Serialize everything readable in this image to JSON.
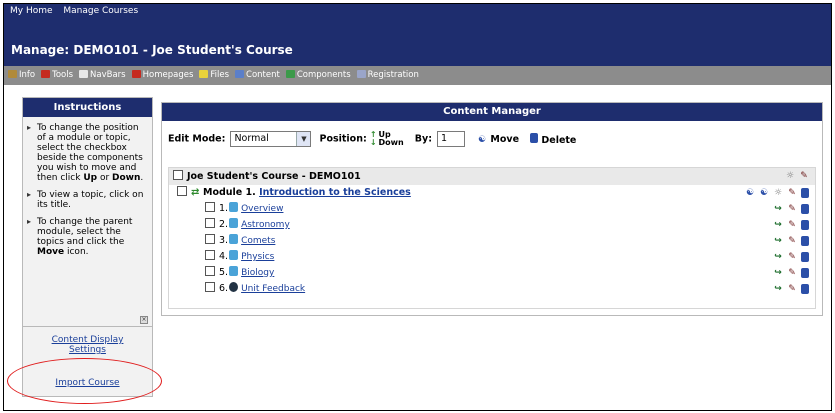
{
  "topnav": {
    "home": "My Home",
    "courses": "Manage Courses"
  },
  "title": "Manage: DEMO101 - Joe Student's Course",
  "toolbar": {
    "items": [
      {
        "label": "Info",
        "color": "#b08a3a"
      },
      {
        "label": "Tools",
        "color": "#c52a1f"
      },
      {
        "label": "NavBars",
        "color": "#e8e8e8"
      },
      {
        "label": "Homepages",
        "color": "#c52a1f"
      },
      {
        "label": "Files",
        "color": "#e9d23a"
      },
      {
        "label": "Content",
        "color": "#5b7fc9"
      },
      {
        "label": "Components",
        "color": "#3c9a4a"
      },
      {
        "label": "Registration",
        "color": "#9aa5c9"
      }
    ]
  },
  "sidebar": {
    "heading": "Instructions",
    "tips": [
      [
        "To change the position of a module or topic, select the checkbox beside the components you wish to move and then click ",
        "Up",
        " or ",
        "Down",
        "."
      ],
      [
        "To view a topic, click on its title.",
        "",
        "",
        "",
        ""
      ],
      [
        "To change the parent module, select the topics and click the ",
        "Move",
        " icon.",
        "",
        ""
      ]
    ],
    "close_icon": "close-icon",
    "link_display": "Content Display Settings",
    "link_import": "Import Course"
  },
  "main": {
    "heading": "Content Manager",
    "edit_mode_label": "Edit Mode:",
    "edit_mode_value": "Normal",
    "position_label": "Position:",
    "up": "Up",
    "down": "Down",
    "by_label": "By:",
    "by_value": "1",
    "move": "Move",
    "delete": "Delete"
  },
  "tree": {
    "course": "Joe Student's Course - DEMO101",
    "module_number": "Module 1.",
    "module_title": "Introduction to the Sciences",
    "topics": [
      {
        "num": "1.",
        "title": "Overview",
        "icon": "page-icon"
      },
      {
        "num": "2.",
        "title": "Astronomy",
        "icon": "page-icon"
      },
      {
        "num": "3.",
        "title": "Comets",
        "icon": "page-icon"
      },
      {
        "num": "4.",
        "title": "Physics",
        "icon": "page-icon"
      },
      {
        "num": "5.",
        "title": "Biology",
        "icon": "page-icon"
      },
      {
        "num": "6.",
        "title": "Unit Feedback",
        "icon": "survey-icon"
      }
    ]
  },
  "colors": {
    "nav": "#1e2d6e",
    "toolbar": "#8c8c8c",
    "link": "#1a3f9a",
    "callout": "#e01c1c"
  }
}
